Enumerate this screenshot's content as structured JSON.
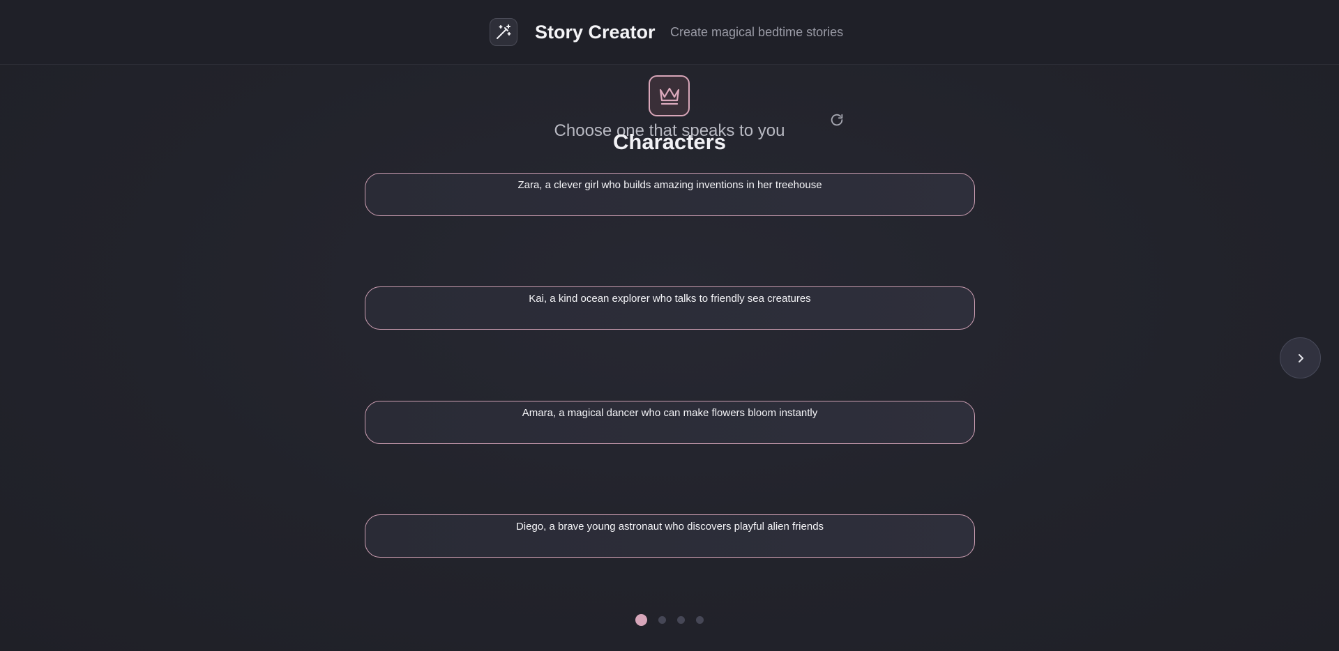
{
  "header": {
    "title": "Story Creator",
    "subtitle": "Create magical bedtime stories",
    "icon": "magic-wand-icon"
  },
  "section": {
    "icon": "crown-icon",
    "subtitle": "Choose one that speaks to you",
    "title": "Characters",
    "refresh_icon": "refresh-icon"
  },
  "options": [
    {
      "label": "Zara, a clever girl who builds amazing inventions in her treehouse"
    },
    {
      "label": "Kai, a kind ocean explorer who talks to friendly sea creatures"
    },
    {
      "label": "Amara, a magical dancer who can make flowers bloom instantly"
    },
    {
      "label": "Diego, a brave young astronaut who discovers playful alien friends"
    }
  ],
  "navigation": {
    "next_icon": "chevron-right-icon",
    "pages": 4,
    "current_page": 1
  },
  "colors": {
    "accent": "#d7a6ba",
    "background": "#22232b",
    "card_border": "#cfa0b4"
  }
}
